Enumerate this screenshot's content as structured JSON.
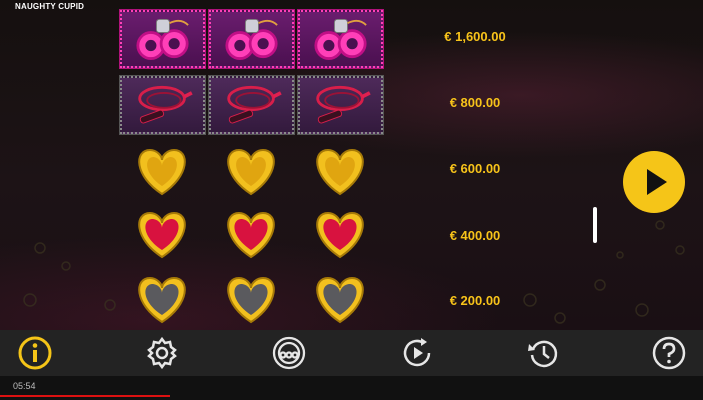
{
  "game": {
    "title": "NAUGHTY CUPID"
  },
  "paytable": [
    {
      "symbol": "handcuffs",
      "count": 3,
      "prize": "€ 1,600.00"
    },
    {
      "symbol": "whip",
      "count": 3,
      "prize": "€ 800.00"
    },
    {
      "symbol": "gold-heart",
      "count": 3,
      "prize": "€ 600.00"
    },
    {
      "symbol": "red-heart",
      "count": 3,
      "prize": "€ 400.00"
    },
    {
      "symbol": "silver-heart",
      "count": 3,
      "prize": "€ 200.00"
    }
  ],
  "colors": {
    "prize_text": "#f7c31a",
    "accent": "#f5c518",
    "toolbar_bg": "#232323"
  },
  "toolbar": {
    "buttons": [
      {
        "name": "info-icon"
      },
      {
        "name": "settings-gear-icon"
      },
      {
        "name": "autoplay-icon"
      },
      {
        "name": "replay-icon"
      },
      {
        "name": "history-icon"
      },
      {
        "name": "help-icon"
      }
    ]
  },
  "status": {
    "clock": "05:54"
  }
}
